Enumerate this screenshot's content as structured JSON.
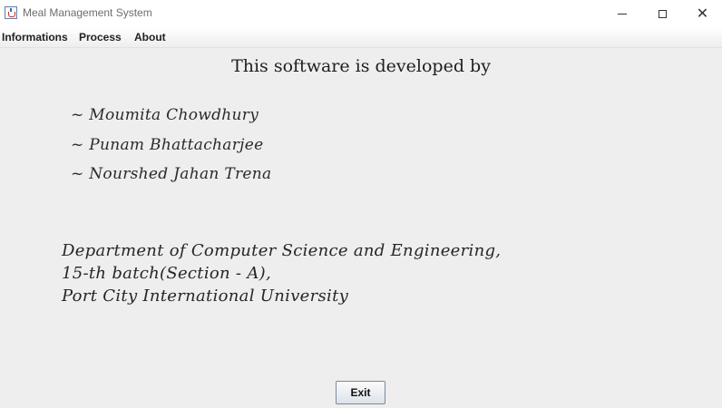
{
  "window": {
    "title": "Meal Management System"
  },
  "titlebar": {
    "app_icon": "java-cup-icon",
    "minimize_icon": "minimize-icon",
    "maximize_icon": "maximize-icon",
    "close_icon": "close-icon",
    "close_glyph": "✕"
  },
  "menubar": {
    "items": [
      {
        "label": "Informations"
      },
      {
        "label": "Process"
      },
      {
        "label": "About"
      }
    ]
  },
  "content": {
    "heading": "This software is developed by",
    "developers": [
      {
        "name": "~ Moumita Chowdhury"
      },
      {
        "name": "~ Punam Bhattacharjee"
      },
      {
        "name": "~ Nourshed Jahan Trena"
      }
    ],
    "department_lines": [
      "Department of Computer Science and Engineering,",
      "15-th batch(Section - A),",
      "Port City International University"
    ]
  },
  "buttons": {
    "exit_label": "Exit"
  }
}
